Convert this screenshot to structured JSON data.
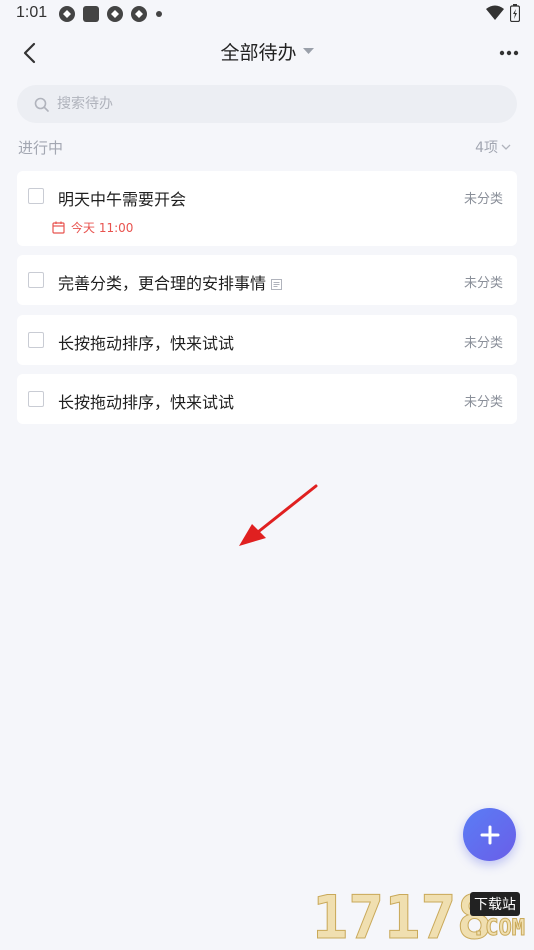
{
  "status_bar": {
    "time": "1:01"
  },
  "header": {
    "title": "全部待办",
    "back_icon": "chevron-left-icon",
    "dropdown_icon": "caret-down-icon",
    "more_icon": "more-horizontal-icon"
  },
  "search": {
    "placeholder": "搜索待办"
  },
  "section": {
    "title": "进行中",
    "count": "4项"
  },
  "tasks": [
    {
      "text": "明天中午需要开会",
      "category": "未分类",
      "due": "今天 11:00"
    },
    {
      "text": "完善分类，更合理的安排事情",
      "category": "未分类"
    },
    {
      "text": "长按拖动排序，快来试试",
      "category": "未分类"
    },
    {
      "text": "长按拖动排序，快来试试",
      "category": "未分类"
    }
  ],
  "colors": {
    "background": "#f5f6fa",
    "due_red": "#e8534f",
    "fab_start": "#5a7df5",
    "fab_end": "#6a5ee8",
    "annotation_arrow": "#e02020"
  },
  "watermark": {
    "digits": "17178",
    "badge": "下载站",
    "suffix": ".COM"
  }
}
